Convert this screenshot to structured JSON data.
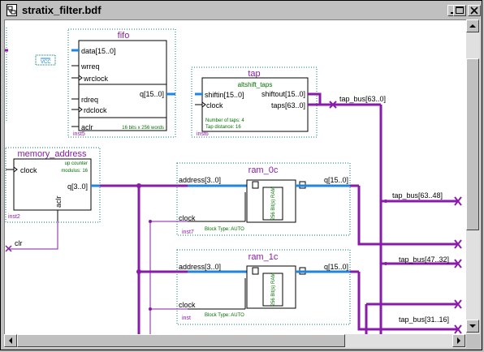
{
  "window": {
    "title": "stratix_filter.bdf",
    "icon": "bdf-file-icon",
    "controls": [
      "minimize-icon",
      "maximize-icon",
      "close-icon"
    ]
  },
  "colors": {
    "bus": "#8a1aab",
    "wire": "#8a1aab",
    "port_bus": "#1f86e0",
    "frame": "#007d7d",
    "label": "#007d7d",
    "green_text": "#007000",
    "pin_x": "#8a1aab"
  },
  "blocks": {
    "vcc": {
      "label": "VCC"
    },
    "fifo": {
      "title": "fifo",
      "ports_in": [
        "data[15..0]",
        "wrreq",
        "wrclock",
        "rdreq",
        "rdclock",
        "aclr"
      ],
      "port_out": "q[15..0]",
      "note": "16 bits x 256 words",
      "inst": "inst5"
    },
    "tap": {
      "title": "tap",
      "subtitle": "altshift_taps",
      "ports_in": [
        "shiftin[15..0]",
        "clock"
      ],
      "ports_out": [
        "shiftout[15..0]",
        "taps[63..0]"
      ],
      "note1": "Number of taps: 4",
      "note2": "Tap distance: 16",
      "inst": "inst6"
    },
    "memory_address": {
      "title": "memory_address",
      "ports_in": [
        "clock"
      ],
      "port_out": "q[3..0]",
      "port_bottom": "aclr",
      "note1": "up counter",
      "note2": "modulus: 16",
      "inst": "inst2"
    },
    "ram_0c": {
      "title": "ram_0c",
      "ports_in": [
        "address[3..0]",
        "clock"
      ],
      "port_out": "q[15..0]",
      "ram_text": "256 Bit(s) RAM",
      "block_type": "Block Type: AUTO",
      "inst": "inst7"
    },
    "ram_1c": {
      "title": "ram_1c",
      "ports_in": [
        "address[3..0]",
        "clock"
      ],
      "port_out": "q[15..0]",
      "ram_text": "256 Bit(s) RAM",
      "block_type": "Block Type: AUTO",
      "inst": "inst"
    }
  },
  "nets": {
    "tap_bus_main": "tap_bus[63..0]",
    "tap_bus_a": "tap_bus[63..48]",
    "tap_bus_b": "tap_bus[47..32]",
    "tap_bus_c": "tap_bus[31..16]",
    "clr": "clr"
  }
}
